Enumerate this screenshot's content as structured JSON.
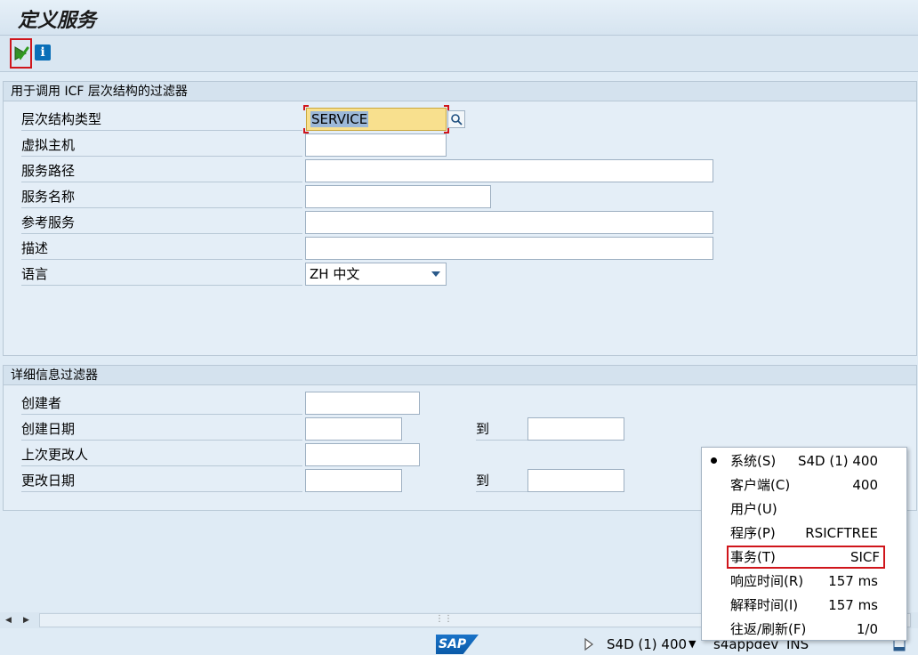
{
  "window": {
    "title": "定义服务"
  },
  "toolbar": {
    "execute_icon": "execute-icon",
    "info_icon": "info-icon",
    "info_glyph": "i"
  },
  "filter_group": {
    "title": "用于调用 ICF 层次结构的过滤器",
    "fields": [
      {
        "label": "层次结构类型",
        "value": "SERVICE"
      },
      {
        "label": "虚拟主机",
        "value": ""
      },
      {
        "label": "服务路径",
        "value": ""
      },
      {
        "label": "服务名称",
        "value": ""
      },
      {
        "label": "参考服务",
        "value": ""
      },
      {
        "label": "描述",
        "value": ""
      },
      {
        "label": "语言",
        "value": "ZH 中文"
      }
    ]
  },
  "detail_group": {
    "title": "详细信息过滤器",
    "fields": [
      {
        "label": "创建者",
        "value": ""
      },
      {
        "label": "创建日期",
        "value": "",
        "to_label": "到",
        "to_value": ""
      },
      {
        "label": "上次更改人",
        "value": ""
      },
      {
        "label": "更改日期",
        "value": "",
        "to_label": "到",
        "to_value": ""
      }
    ]
  },
  "system_popup": {
    "items": [
      {
        "label": "系统(S)",
        "value": "S4D (1) 400",
        "selected": true
      },
      {
        "label": "客户端(C)",
        "value": "400"
      },
      {
        "label": "用户(U)",
        "value": ""
      },
      {
        "label": "程序(P)",
        "value": "RSICFTREE"
      },
      {
        "label": "事务(T)",
        "value": "SICF",
        "highlighted": true
      },
      {
        "label": "响应时间(R)",
        "value": "157 ms"
      },
      {
        "label": "解释时间(I)",
        "value": "157 ms"
      },
      {
        "label": "往返/刷新(F)",
        "value": "1/0"
      }
    ]
  },
  "statusbar": {
    "logo": "SAP",
    "system": "S4D (1) 400",
    "server": "s4appdev",
    "mode": "INS"
  },
  "colors": {
    "accent_red": "#d0151b",
    "highlight_field": "#f8e08e",
    "sap_blue": "#0a5aa8"
  }
}
